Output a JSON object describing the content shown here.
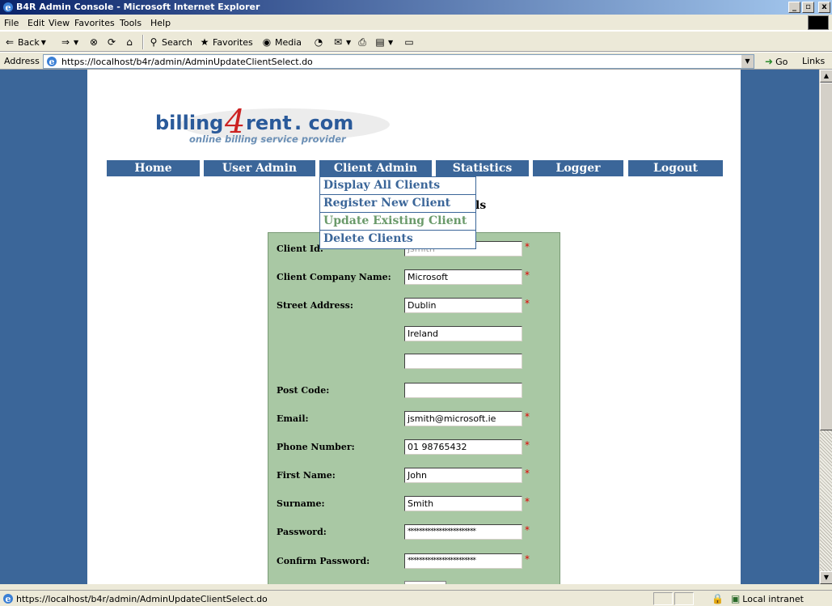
{
  "window": {
    "title": "B4R Admin Console - Microsoft Internet Explorer",
    "min_icon": "_",
    "max_icon": "▫",
    "close_icon": "x"
  },
  "menubar": [
    "File",
    "Edit",
    "View",
    "Favorites",
    "Tools",
    "Help"
  ],
  "toolbar": {
    "back": "Back",
    "search": "Search",
    "favorites": "Favorites",
    "media": "Media"
  },
  "address": {
    "label": "Address",
    "url": "https://localhost/b4r/admin/AdminUpdateClientSelect.do",
    "go": "Go",
    "links": "Links"
  },
  "logo": {
    "brand_a": "billing",
    "brand_num": "4",
    "brand_b": "rent",
    "brand_c": ". com",
    "tagline": "online billing service provider"
  },
  "nav": [
    "Home",
    "User Admin",
    "Client Admin",
    "Statistics",
    "Logger",
    "Logout"
  ],
  "dropdown": {
    "items": [
      "Display All Clients",
      "Register New Client",
      "Update Existing Client",
      "Delete Clients"
    ],
    "active_index": 2
  },
  "heading_fragment": "ls",
  "form": {
    "fields": [
      {
        "label": "Client Id:",
        "value": "jsmith",
        "required": true,
        "disabled": true
      },
      {
        "label": "Client Company Name:",
        "value": "Microsoft",
        "required": true
      },
      {
        "label": "Street Address:",
        "value": "Dublin",
        "required": true
      },
      {
        "label": "",
        "value": "Ireland",
        "required": false
      },
      {
        "label": "",
        "value": "",
        "required": false
      },
      {
        "label": "Post Code:",
        "value": "",
        "required": false
      },
      {
        "label": "Email:",
        "value": "jsmith@microsoft.ie",
        "required": true
      },
      {
        "label": "Phone Number:",
        "value": "01 98765432",
        "required": true
      },
      {
        "label": "First Name:",
        "value": "John",
        "required": true
      },
      {
        "label": "Surname:",
        "value": "Smith",
        "required": true
      },
      {
        "label": "Password:",
        "value": "************************",
        "required": true,
        "password": true
      },
      {
        "label": "Confirm Password:",
        "value": "************************",
        "required": true,
        "password": true
      }
    ],
    "required_mark": "*"
  },
  "status": {
    "text": "https://localhost/b4r/admin/AdminUpdateClientSelect.do",
    "zone": "Local intranet"
  },
  "colors": {
    "nav_bg": "#3b6699",
    "form_bg": "#a9c8a4",
    "required": "#e00000",
    "active_menu": "#6a9a6a"
  }
}
